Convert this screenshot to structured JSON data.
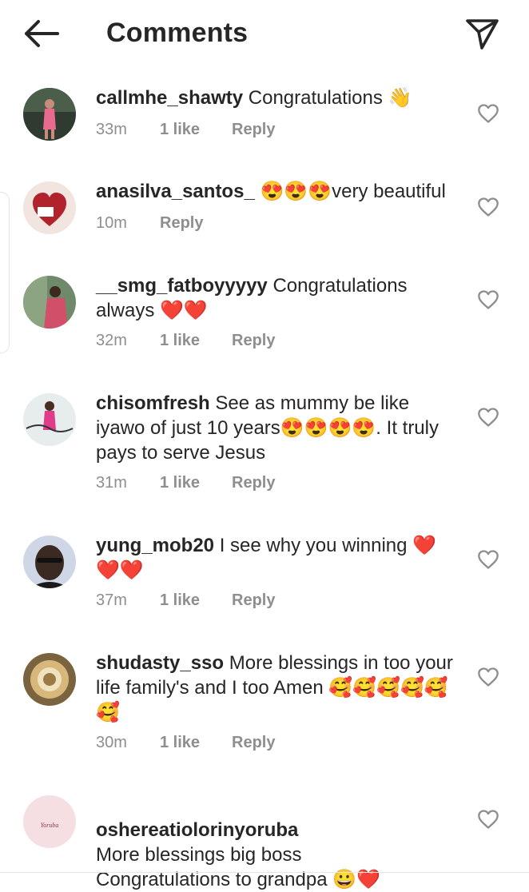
{
  "header": {
    "title": "Comments",
    "back_icon": "arrow-left-icon",
    "send_icon": "paper-plane-icon"
  },
  "comments": [
    {
      "username": "callmhe_shawty",
      "text": "Congratulations 👋",
      "time": "33m",
      "likes": "1 like",
      "reply": "Reply"
    },
    {
      "username": "anasilva_santos_",
      "text": "😍😍😍very beautiful",
      "time": "10m",
      "likes": "",
      "reply": "Reply"
    },
    {
      "username": "__smg_fatboyyyyy",
      "text": "Congratulations always ❤️❤️",
      "time": "32m",
      "likes": "1 like",
      "reply": "Reply"
    },
    {
      "username": "chisomfresh",
      "text": "See as mummy be like iyawo of just 10 years😍😍😍😍. It truly pays to serve Jesus",
      "time": "31m",
      "likes": "1 like",
      "reply": "Reply"
    },
    {
      "username": "yung_mob20",
      "text": "I see why you winning ❤️❤️❤️",
      "time": "37m",
      "likes": "1 like",
      "reply": "Reply"
    },
    {
      "username": "shudasty_sso",
      "text": "More blessings in too your life family's and I too Amen 🥰🥰🥰🥰🥰🥰",
      "time": "30m",
      "likes": "1 like",
      "reply": "Reply"
    },
    {
      "username": "oshereatiolorinyoruba",
      "text": "More blessings big boss\nCongratulations to grandpa 😀❤️",
      "time": "",
      "likes": "",
      "reply": "",
      "avatar_text": "Oshere ati Olorin Yoruba NEWS"
    }
  ],
  "colors": {
    "text": "#262626",
    "meta": "#8e8e8e",
    "heart_red": "#e0202a"
  }
}
